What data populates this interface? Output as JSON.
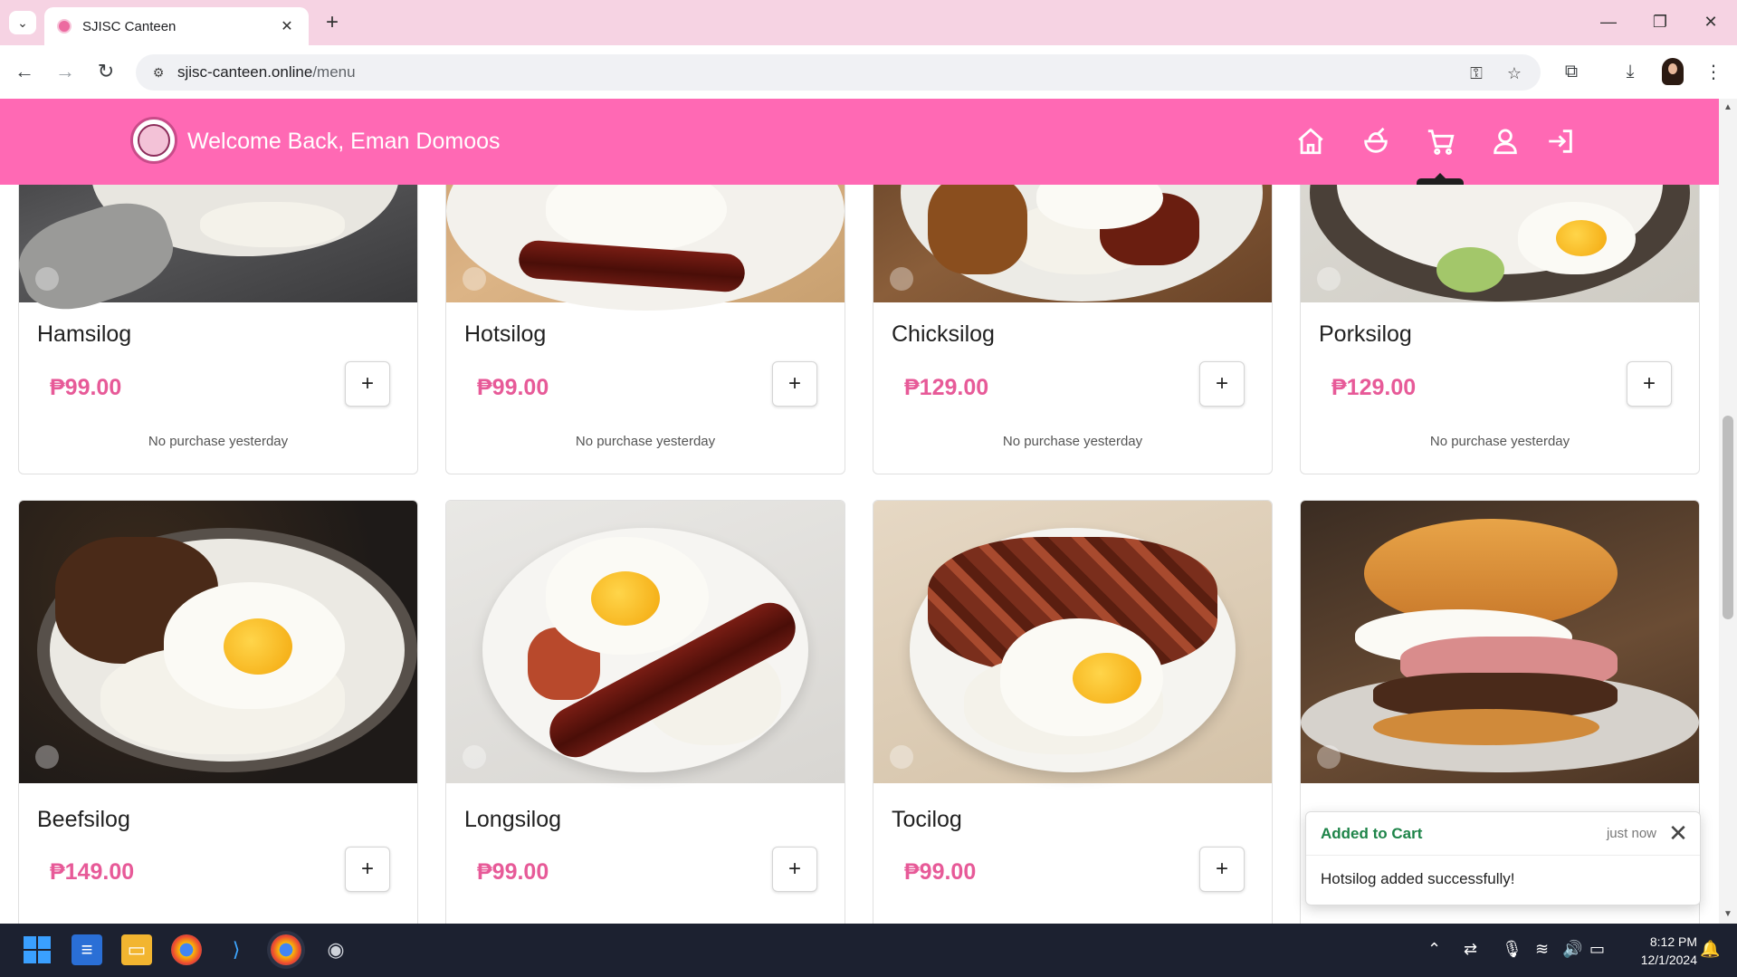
{
  "browser": {
    "tab_title": "SJISC Canteen",
    "url_host": "sjisc-canteen.online",
    "url_path": "/menu"
  },
  "header": {
    "welcome": "Welcome Back, Eman Domoos",
    "tooltip": "Cart",
    "nav_icons": [
      "home-icon",
      "food-icon",
      "cart-icon",
      "user-icon",
      "logout-icon"
    ]
  },
  "menu": {
    "items": [
      {
        "name": "Hamsilog",
        "price": "₱99.00",
        "note": "No purchase yesterday",
        "add_label": "+"
      },
      {
        "name": "Hotsilog",
        "price": "₱99.00",
        "note": "No purchase yesterday",
        "add_label": "+"
      },
      {
        "name": "Chicksilog",
        "price": "₱129.00",
        "note": "No purchase yesterday",
        "add_label": "+"
      },
      {
        "name": "Porksilog",
        "price": "₱129.00",
        "note": "No purchase yesterday",
        "add_label": "+"
      },
      {
        "name": "Beefsilog",
        "price": "₱149.00",
        "add_label": "+"
      },
      {
        "name": "Longsilog",
        "price": "₱99.00",
        "add_label": "+"
      },
      {
        "name": "Tocilog",
        "price": "₱99.00",
        "add_label": "+"
      }
    ]
  },
  "toast": {
    "title": "Added to Cart",
    "time": "just now",
    "message": "Hotsilog added successfully!"
  },
  "taskbar": {
    "time": "8:12 PM",
    "date": "12/1/2024"
  },
  "colors": {
    "header_bg": "#ff69b4",
    "price": "#e75a98",
    "toast_title": "#1e8449",
    "taskbar_bg": "#1c2130"
  }
}
